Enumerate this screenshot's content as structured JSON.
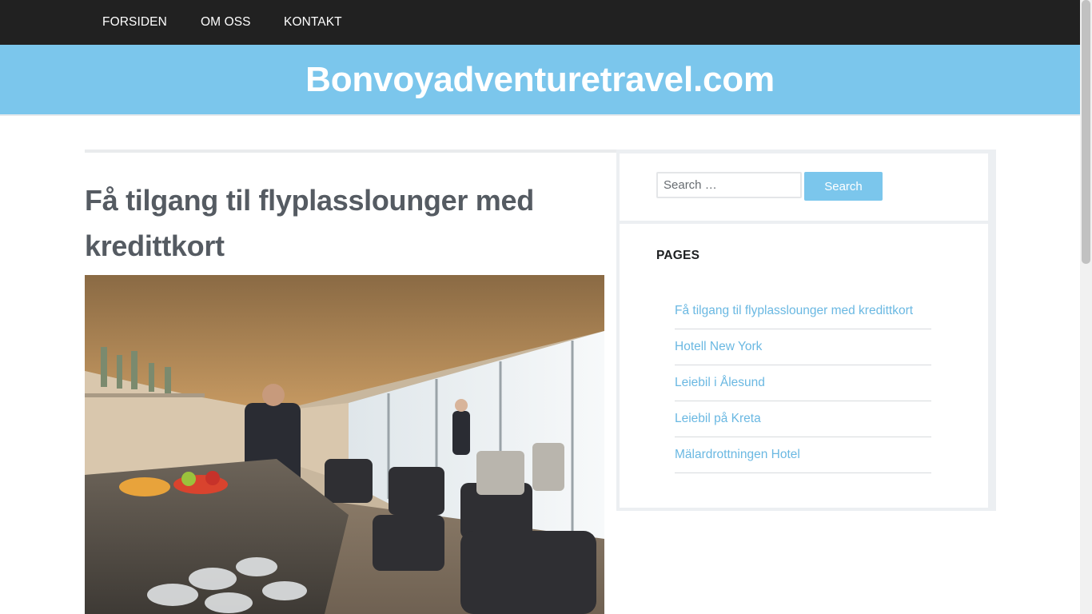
{
  "nav": {
    "items": [
      {
        "label": "FORSIDEN"
      },
      {
        "label": "OM OSS"
      },
      {
        "label": "KONTAKT"
      }
    ]
  },
  "site": {
    "title": "Bonvoyadventuretravel.com"
  },
  "post": {
    "title": "Få tilgang til flyplasslounger med kredittkort"
  },
  "search": {
    "placeholder": "Search …",
    "button_label": "Search"
  },
  "pages_widget": {
    "heading": "PAGES",
    "items": [
      {
        "label": "Få tilgang til flyplasslounger med kredittkort"
      },
      {
        "label": "Hotell New York"
      },
      {
        "label": "Leiebil i Ålesund"
      },
      {
        "label": "Leiebil på Kreta"
      },
      {
        "label": "Mälardrottningen Hotel"
      }
    ]
  },
  "colors": {
    "nav_bg": "#212121",
    "banner_bg": "#7bc6ec",
    "link": "#6ab8e2",
    "title_text": "#555b62"
  }
}
